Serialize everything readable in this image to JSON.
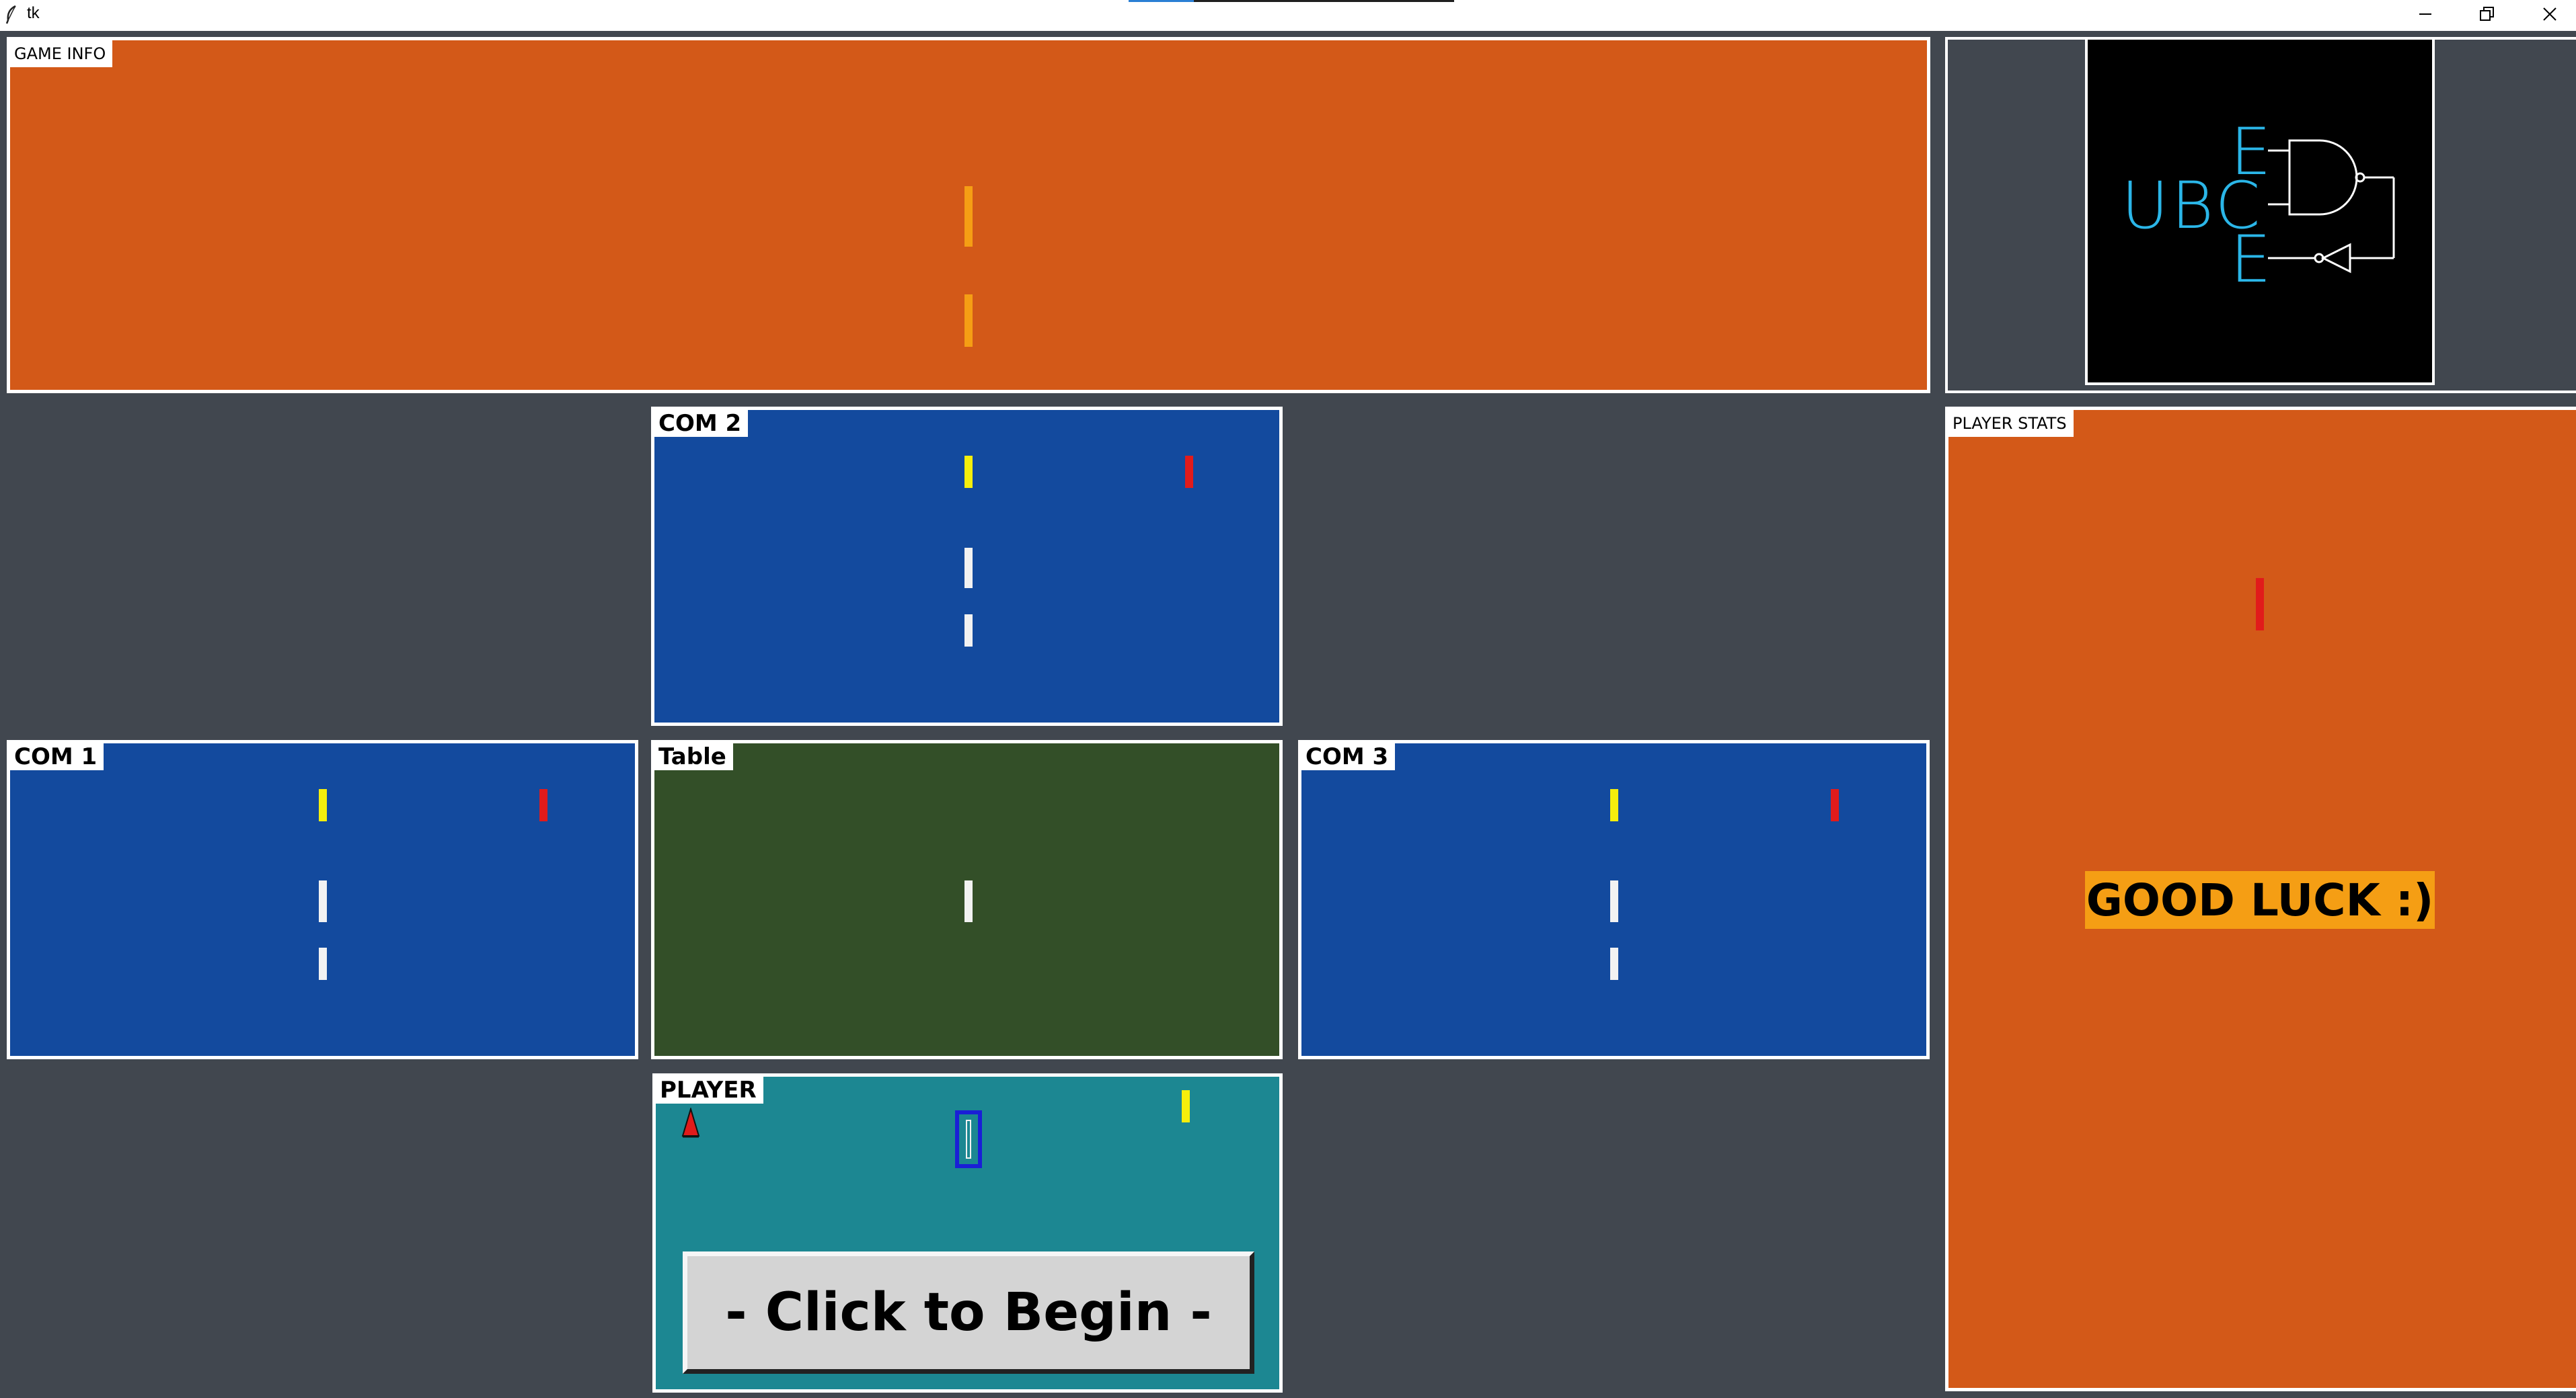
{
  "window": {
    "title": "tk",
    "icon": "feather-icon",
    "controls": [
      "minimize-icon",
      "restore-icon",
      "close-icon"
    ],
    "progress_fraction": 0.2
  },
  "game_info": {
    "label": "GAME INFO"
  },
  "logo": {
    "letters_top": "E",
    "letters_mid": "UBC",
    "letters_bottom": "E",
    "color": "#2bb6e8"
  },
  "com2": {
    "label": "COM 2"
  },
  "com1": {
    "label": "COM 1"
  },
  "table": {
    "label": "Table"
  },
  "com3": {
    "label": "COM 3"
  },
  "player": {
    "label": "PLAYER",
    "begin_button": "- Click to Begin -"
  },
  "player_stats": {
    "label": "PLAYER STATS",
    "message": "GOOD LUCK :)"
  },
  "colors": {
    "background": "#41474f",
    "game_info_bg": "#d35918",
    "com_bg": "#134a9e",
    "table_bg": "#334f28",
    "player_bg": "#1c8792",
    "stats_bg": "#d35918",
    "marker_orange": "#f59e14",
    "marker_yellow": "#f5ee0c",
    "marker_red": "#e11b1b",
    "marker_white": "#f2f2f2",
    "message_bg": "#f59e14"
  }
}
